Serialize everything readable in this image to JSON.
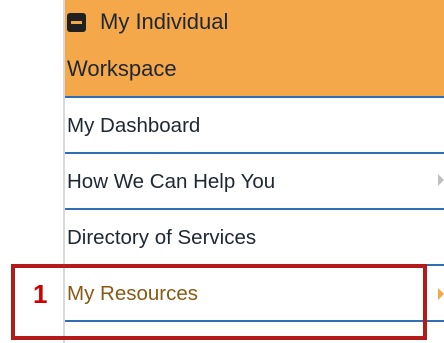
{
  "menu": {
    "header": {
      "line1": "My Individual",
      "line2": "Workspace",
      "icon": "collapse-square-minus-icon"
    },
    "items": [
      {
        "label": "My Dashboard",
        "has_submenu": false
      },
      {
        "label": "How We Can Help You",
        "has_submenu": true
      },
      {
        "label": "Directory of Services",
        "has_submenu": false
      },
      {
        "label": "My Resources",
        "has_submenu": true,
        "active": true
      }
    ]
  },
  "annotation": {
    "step_number": "1",
    "color": "#d00000"
  },
  "colors": {
    "header_bg": "#f5a84a",
    "divider": "#2e6fb5",
    "highlight": "#b31b1b",
    "active_text": "#8a5a14"
  }
}
